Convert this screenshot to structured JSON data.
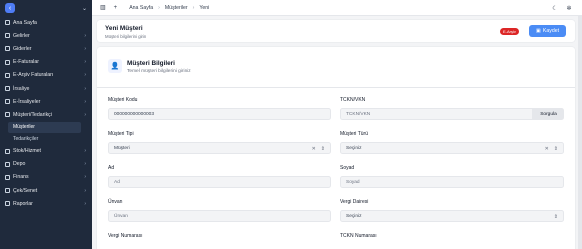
{
  "sidebar": {
    "items": [
      {
        "label": "Ana Sayfa",
        "chevron": false
      },
      {
        "label": "Gelirler",
        "chevron": true
      },
      {
        "label": "Giderler",
        "chevron": true
      },
      {
        "label": "E-Faturalar",
        "chevron": true
      },
      {
        "label": "E-Arşiv Faturaları",
        "chevron": true
      },
      {
        "label": "İrsaliye",
        "chevron": true
      },
      {
        "label": "E-İrsaliyeler",
        "chevron": true
      },
      {
        "label": "Müşteri/Tedarikçi",
        "chevron": true
      }
    ],
    "subitems": [
      {
        "label": "Müşteriler",
        "active": true
      },
      {
        "label": "Tedarikçiler",
        "active": false
      }
    ],
    "items_after": [
      {
        "label": "Stok/Hizmet"
      },
      {
        "label": "Depo"
      },
      {
        "label": "Finans"
      },
      {
        "label": "Çek/Senet"
      },
      {
        "label": "Raporlar"
      }
    ]
  },
  "topbar": {
    "sidebar_toggle_icon": "panel-icon",
    "add_icon": "plus-icon",
    "breadcrumb": [
      "Ana Sayfa",
      "Müşteriler",
      "Yeni"
    ]
  },
  "page": {
    "title": "Yeni Müşteri",
    "subtitle": "Müşteri bilgilerini girin",
    "badge": "E-Arşiv",
    "save_label": "Kaydet"
  },
  "card": {
    "title": "Müşteri Bilgileri",
    "subtitle": "Temel müşteri bilgilerini giriniz"
  },
  "form": {
    "musteri_kodu": {
      "label": "Müşteri Kodu",
      "value": "000000000000003"
    },
    "tckn_vkn": {
      "label": "TCKN/VKN",
      "placeholder": "TCKN/VKN",
      "button": "Sorgula"
    },
    "musteri_tipi": {
      "label": "Müşteri Tipi",
      "value": "Müşteri"
    },
    "musteri_turu": {
      "label": "Müşteri Türü",
      "value": "Seçiniz"
    },
    "ad": {
      "label": "Ad",
      "placeholder": "Ad"
    },
    "soyad": {
      "label": "Soyad",
      "placeholder": "Soyad"
    },
    "unvan": {
      "label": "Ünvan",
      "placeholder": "Ünvan"
    },
    "vergi_dairesi": {
      "label": "Vergi Dairesi",
      "value": "Seçiniz"
    },
    "vergi_numarasi": {
      "label": "Vergi Numarası"
    },
    "tckn_numarasi": {
      "label": "TCKN Numarası"
    }
  }
}
